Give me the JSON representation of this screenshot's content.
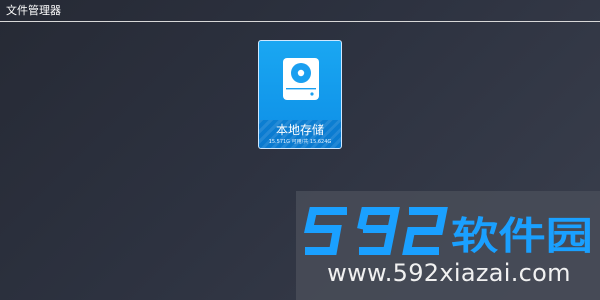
{
  "app": {
    "title": "文件管理器"
  },
  "storage": {
    "label": "本地存储",
    "capacity": "15.571G 可用/共 15.624G",
    "icon": "hard-disk-icon"
  },
  "watermark": {
    "logo_text": "592软件园",
    "url": "www.592xiazai.com"
  },
  "colors": {
    "background": "#2b2f3b",
    "tile": "#0d8ee6",
    "watermark_accent": "#1aa0ff"
  }
}
